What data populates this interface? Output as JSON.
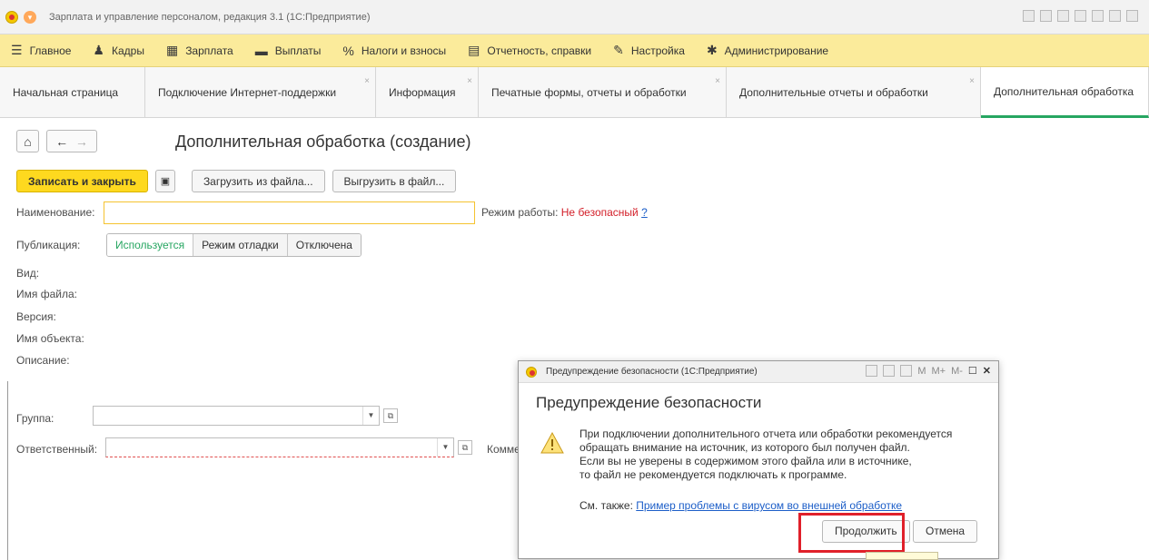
{
  "window": {
    "title": "Зарплата и управление персоналом, редакция 3.1  (1С:Предприятие)"
  },
  "menu": [
    {
      "icon": "menu-lines-icon",
      "label": "Главное"
    },
    {
      "icon": "people-icon",
      "label": "Кадры"
    },
    {
      "icon": "calculator-icon",
      "label": "Зарплата"
    },
    {
      "icon": "money-icon",
      "label": "Выплаты"
    },
    {
      "icon": "percent-icon",
      "label": "Налоги и взносы"
    },
    {
      "icon": "reports-icon",
      "label": "Отчетность, справки"
    },
    {
      "icon": "wrench-icon",
      "label": "Настройка"
    },
    {
      "icon": "gear-icon",
      "label": "Администрирование"
    }
  ],
  "tabs": [
    {
      "label": "Начальная страница"
    },
    {
      "label": "Подключение Интернет-поддержки"
    },
    {
      "label": "Информация"
    },
    {
      "label": "Печатные формы, отчеты и обработки"
    },
    {
      "label": "Дополнительные отчеты и обработки"
    },
    {
      "label": "Дополнительная обработка"
    }
  ],
  "page": {
    "title": "Дополнительная обработка (создание)"
  },
  "toolbar": {
    "save_close": "Записать и закрыть",
    "load_file": "Загрузить из файла...",
    "unload_file": "Выгрузить в файл..."
  },
  "form": {
    "name_label": "Наименование:",
    "mode_label": "Режим работы:",
    "mode_value": "Не безопасный",
    "mode_help": "?",
    "publication_label": "Публикация:",
    "publication_options": [
      "Используется",
      "Режим отладки",
      "Отключена"
    ],
    "kind_label": "Вид:",
    "filename_label": "Имя файла:",
    "version_label": "Версия:",
    "object_label": "Имя объекта:",
    "description_label": "Описание:",
    "group_label": "Группа:",
    "responsible_label": "Ответственный:",
    "comment_label_partial": "Комме"
  },
  "dialog": {
    "window_title": "Предупреждение безопасности  (1С:Предприятие)",
    "header": "Предупреждение безопасности",
    "message_lines": [
      "При подключении дополнительного отчета или обработки рекомендуется",
      "обращать внимание на источник, из которого был получен файл.",
      "Если вы не уверены в содержимом этого файла или в источнике,",
      "то файл не рекомендуется подключать к программе."
    ],
    "see_also_label": "См. также:",
    "see_also_link": "Пример проблемы с вирусом во внешней обработке",
    "tools": [
      "M",
      "M+",
      "M-"
    ],
    "continue": "Продолжить",
    "cancel": "Отмена"
  },
  "colors": {
    "accent_yellow": "#fed91f",
    "menu_bg": "#fbeb9b",
    "active_green": "#26a661",
    "warning_red": "#d3202a",
    "link_blue": "#1c5ec8"
  }
}
